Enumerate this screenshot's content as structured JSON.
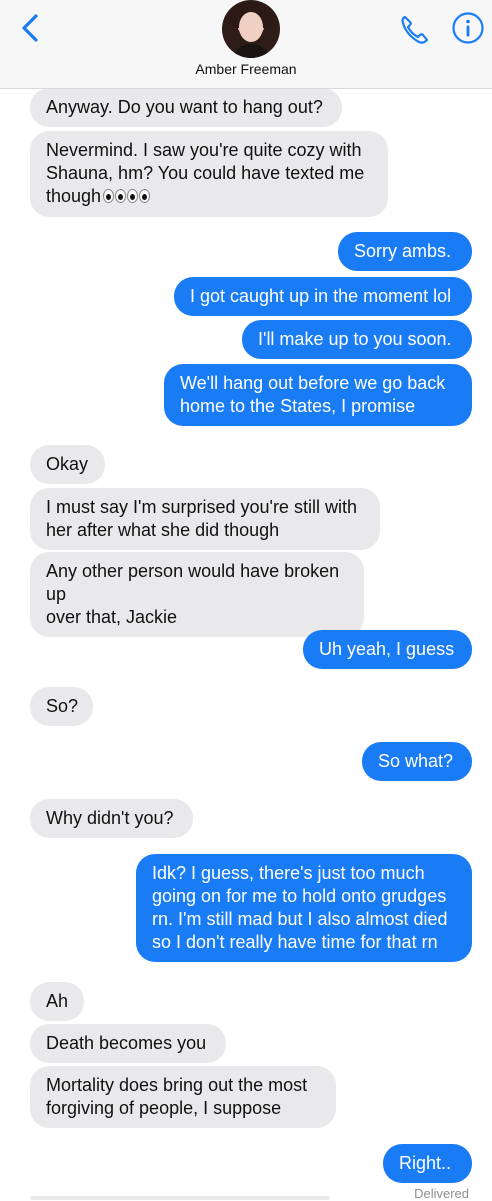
{
  "header": {
    "contact_name": "Amber Freeman",
    "icons": [
      "chevron-left-icon",
      "phone-icon",
      "info-icon"
    ],
    "accent_color": "#1a7cf5"
  },
  "messages": [
    {
      "dir": "in",
      "text": "Anyway. Do you want to hang out?"
    },
    {
      "dir": "in",
      "text": "Nevermind. I saw you're quite cozy with\nShauna, hm? You could have texted me\nthough"
    },
    {
      "dir": "out",
      "text": "Sorry ambs."
    },
    {
      "dir": "out",
      "text": "I got caught up in the moment lol"
    },
    {
      "dir": "out",
      "text": "I'll make up to you soon."
    },
    {
      "dir": "out",
      "text": "We'll hang out before we go back\nhome to the States, I promise"
    },
    {
      "dir": "in",
      "text": "Okay"
    },
    {
      "dir": "in",
      "text": "I must say I'm surprised you're still with\nher after what she did though"
    },
    {
      "dir": "in",
      "text": "Any other person would have broken up\nover that, Jackie"
    },
    {
      "dir": "out",
      "text": "Uh yeah, I guess"
    },
    {
      "dir": "in",
      "text": "So?"
    },
    {
      "dir": "out",
      "text": "So what?"
    },
    {
      "dir": "in",
      "text": "Why didn't you?"
    },
    {
      "dir": "out",
      "text": "Idk? I guess, there's just too much\ngoing on for me to hold onto grudges\nrn. I'm still mad but I also almost died\nso I don't really have time for that rn"
    },
    {
      "dir": "in",
      "text": "Ah"
    },
    {
      "dir": "in",
      "text": "Death becomes you"
    },
    {
      "dir": "in",
      "text": "Mortality does bring out the most\nforgiving of people, I suppose"
    },
    {
      "dir": "out",
      "text": "Right.."
    }
  ],
  "status": {
    "delivered": "Delivered"
  }
}
